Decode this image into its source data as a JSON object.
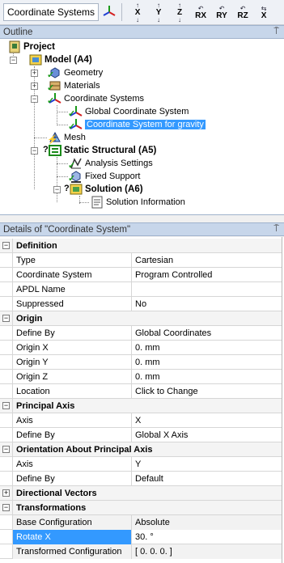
{
  "toolbar": {
    "label": "Coordinate Systems",
    "buttons": [
      {
        "sym": "X",
        "name": "flip-x-button"
      },
      {
        "sym": "Y",
        "name": "flip-y-button"
      },
      {
        "sym": "Z",
        "name": "flip-z-button"
      },
      {
        "sym": "RX",
        "name": "rotate-x-button"
      },
      {
        "sym": "RY",
        "name": "rotate-y-button"
      },
      {
        "sym": "RZ",
        "name": "rotate-z-button"
      },
      {
        "sym": "X",
        "name": "translate-x-button"
      }
    ]
  },
  "outline": {
    "title": "Outline",
    "pin": "⍑",
    "nodes": {
      "project": "Project",
      "model": "Model (A4)",
      "geometry": "Geometry",
      "materials": "Materials",
      "coord_systems": "Coordinate Systems",
      "global_cs": "Global Coordinate System",
      "gravity_cs": "Coordinate System for gravity",
      "mesh": "Mesh",
      "static": "Static Structural (A5)",
      "analysis": "Analysis Settings",
      "fixed": "Fixed Support",
      "solution": "Solution (A6)",
      "sol_info": "Solution Information"
    }
  },
  "details": {
    "title": "Details of \"Coordinate System\"",
    "pin": "⍑",
    "sections": {
      "definition": "Definition",
      "origin": "Origin",
      "principal": "Principal Axis",
      "orientation": "Orientation About Principal Axis",
      "directional": "Directional Vectors",
      "transformations": "Transformations"
    },
    "rows": {
      "type": [
        "Type",
        "Cartesian"
      ],
      "coord_system": [
        "Coordinate System",
        "Program Controlled"
      ],
      "apdl": [
        "APDL Name",
        ""
      ],
      "suppressed": [
        "Suppressed",
        "No"
      ],
      "define_by": [
        "Define By",
        "Global Coordinates"
      ],
      "origin_x": [
        "Origin X",
        "0. mm"
      ],
      "origin_y": [
        "Origin Y",
        "0. mm"
      ],
      "origin_z": [
        "Origin Z",
        "0. mm"
      ],
      "location": [
        "Location",
        "Click to Change"
      ],
      "axis1": [
        "Axis",
        "X"
      ],
      "define_by2": [
        "Define By",
        "Global X Axis"
      ],
      "axis2": [
        "Axis",
        "Y"
      ],
      "define_by3": [
        "Define By",
        "Default"
      ],
      "base_config": [
        "Base Configuration",
        "Absolute"
      ],
      "rotate_x": [
        "Rotate X",
        "30. °"
      ],
      "transformed": [
        "Transformed Configuration",
        "[ 0. 0. 0. ]"
      ]
    }
  }
}
